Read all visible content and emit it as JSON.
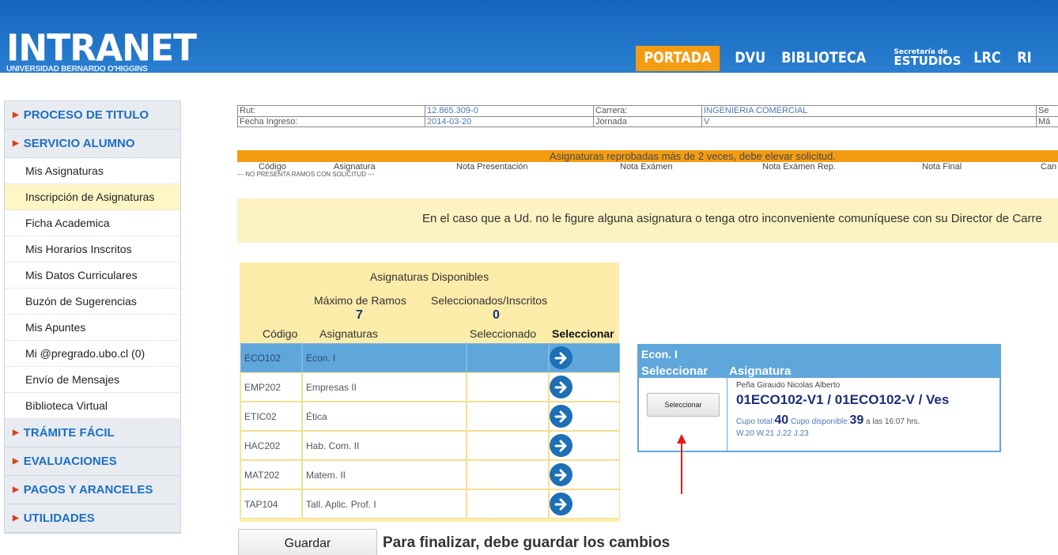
{
  "header": {
    "logo_main": "INTRANET",
    "logo_sub": "UNIVERSIDAD BERNARDO O'HIGGINS",
    "nav": [
      {
        "label": "PORTADA"
      },
      {
        "label": "DVU"
      },
      {
        "label": "BIBLIOTECA"
      },
      {
        "label_line1": "Secretaría de",
        "label_line2": "ESTUDIOS"
      },
      {
        "label": "LRC"
      },
      {
        "label": "RI"
      }
    ]
  },
  "sidebar": {
    "items": [
      {
        "label": "PROCESO DE TITULO"
      },
      {
        "label": "SERVICIO ALUMNO"
      },
      {
        "label": "Mis Asignaturas"
      },
      {
        "label": "Inscripción de Asignaturas"
      },
      {
        "label": "Ficha Academica"
      },
      {
        "label": "Mis Horarios Inscritos"
      },
      {
        "label": "Mis Datos Curriculares"
      },
      {
        "label": "Buzón de Sugerencias"
      },
      {
        "label": "Mis Apuntes"
      },
      {
        "label": "Mi @pregrado.ubo.cl (0)"
      },
      {
        "label": "Envío de Mensajes"
      },
      {
        "label": "Biblioteca Virtual"
      },
      {
        "label": "TRÁMITE FÁCIL"
      },
      {
        "label": "EVALUACIONES"
      },
      {
        "label": "PAGOS Y ARANCELES"
      },
      {
        "label": "UTILIDADES"
      }
    ]
  },
  "student": {
    "rut_label": "Rut:",
    "rut": "12.865.309-0",
    "carrera_label": "Carrera:",
    "carrera": "INGENIERIA COMERCIAL",
    "sede_label": "Se",
    "fecha_label": "Fecha Ingreso:",
    "fecha": "2014-03-20",
    "jornada_label": "Jornada",
    "jornada": "V",
    "max_label": "Má"
  },
  "reprobadas": {
    "title": "Asignaturas reprobadas más de 2 veces, debe elevar solicitud.",
    "columns": [
      "Código",
      "Asignatura",
      "Nota Presentación",
      "Nota Exámen",
      "Nota Exámen Rep.",
      "Nota Final",
      "Can"
    ],
    "empty": "--- NO PRESENTA RAMOS CON SOLICITUD ---"
  },
  "notice": "En el caso que a Ud. no le figure alguna asignatura o tenga otro inconveniente comuníquese con su Director de Carre",
  "disponibles": {
    "title": "Asignaturas Disponibles",
    "max_label": "Máximo de Ramos",
    "max_value": "7",
    "sel_label": "Seleccionados/Inscritos",
    "sel_value": "0",
    "col_codigo": "Código",
    "col_asignaturas": "Asignaturas",
    "col_seleccionado": "Seleccionado",
    "col_seleccionar": "Seleccionar",
    "rows": [
      {
        "code": "ECO102",
        "name": "Econ. I"
      },
      {
        "code": "EMP202",
        "name": "Empresas II"
      },
      {
        "code": "ETIC02",
        "name": "Ética"
      },
      {
        "code": "HAC202",
        "name": "Hab. Com. II"
      },
      {
        "code": "MAT202",
        "name": "Matem. II"
      },
      {
        "code": "TAP104",
        "name": "Tall. Aplic. Prof. I"
      }
    ]
  },
  "econ_panel": {
    "title": "Econ. I",
    "col_seleccionar": "Seleccionar",
    "col_asignatura": "Asignatura",
    "button": "Seleccionar",
    "profesor": "Peña Giraudo Nicolas Alberto",
    "code": "01ECO102-V1 / 01ECO102-V / Ves",
    "cupo_total_label": "Cupo total:",
    "cupo_total": "40",
    "cupo_disp_label": "Cupo disponible:",
    "cupo_disp": "39",
    "cupo_time": "a las 16:07 hrs.",
    "horario": "W.20 W.21 J.22 J.23"
  },
  "footer": {
    "guardar": "Guardar",
    "finalizar": "Para finalizar, debe guardar los cambios"
  },
  "colors": {
    "header_blue": "#1c6fc4",
    "orange": "#f39c12",
    "yellow_panel": "#fbecaa",
    "selected_blue": "#5fa6db",
    "code_navy": "#1a2f7a"
  }
}
